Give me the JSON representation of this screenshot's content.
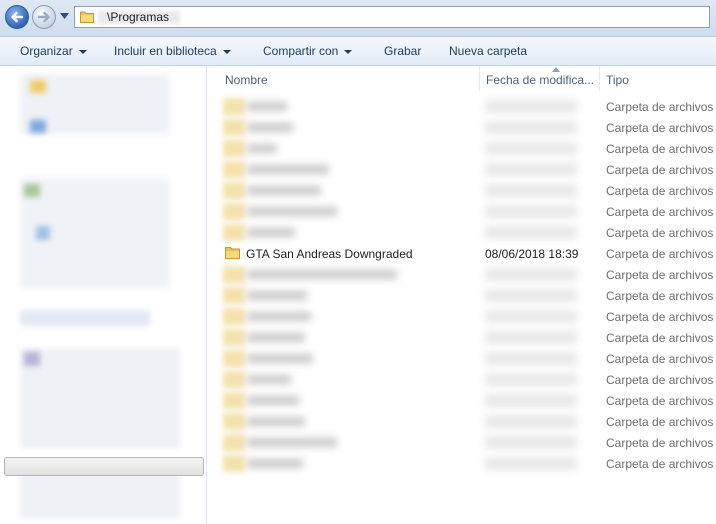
{
  "address": {
    "path": "\\Programas"
  },
  "toolbar": {
    "organize": "Organizar",
    "include_library": "Incluir en biblioteca",
    "share_with": "Compartir con",
    "burn": "Grabar",
    "new_folder": "Nueva carpeta"
  },
  "columns": {
    "name": "Nombre",
    "date": "Fecha de modifica...",
    "type": "Tipo"
  },
  "file_type_label": "Carpeta de archivos",
  "visible_item": {
    "name": "GTA San Andreas Downgraded",
    "date": "08/06/2018 18:39",
    "type": "Carpeta de archivos"
  },
  "row_types": [
    "Carpeta de archivos",
    "Carpeta de archivos",
    "Carpeta de archivos",
    "Carpeta de archivos",
    "Carpeta de archivos",
    "Carpeta de archivos",
    "Carpeta de archivos",
    "Carpeta de archivos",
    "Carpeta de archivos",
    "Carpeta de archivos",
    "Carpeta de archivos",
    "Carpeta de archivos",
    "Carpeta de archivos",
    "Carpeta de archivos",
    "Carpeta de archivos",
    "Carpeta de archivos",
    "Carpeta de archivos",
    "Carpeta de archivos"
  ],
  "colors": {
    "folder": "#e8c25a",
    "accent": "#2d63b7",
    "header_text": "#4c607a",
    "type_text": "#6d6d6d"
  }
}
